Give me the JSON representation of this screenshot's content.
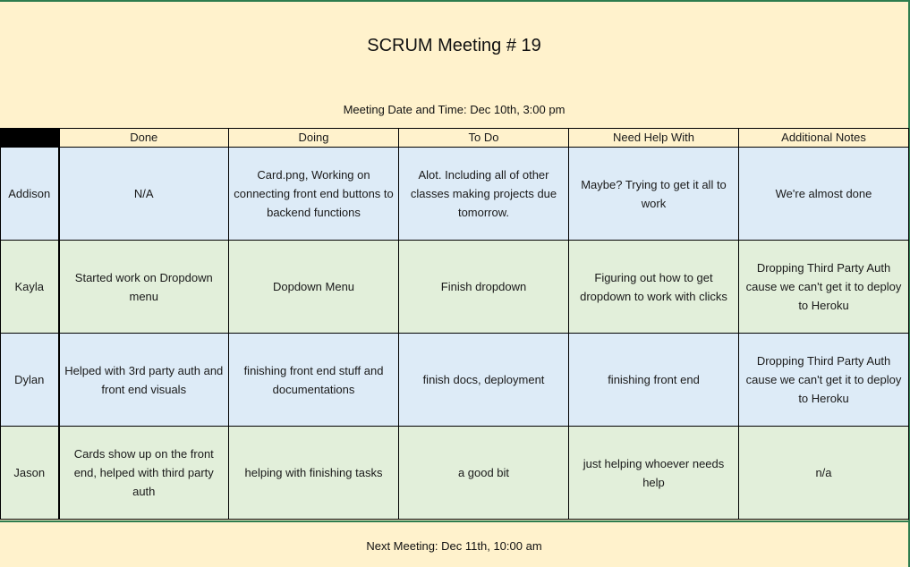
{
  "title": "SCRUM Meeting # 19",
  "meeting_date": "Meeting Date and Time: Dec 10th, 3:00 pm",
  "columns": [
    "Done",
    "Doing",
    "To Do",
    "Need Help With",
    "Additional Notes"
  ],
  "rows": [
    {
      "name": "Addison",
      "cells": [
        "N/A",
        "Card.png, Working on connecting front end buttons to backend functions",
        "Alot. Including all of other classes making projects due tomorrow.",
        "Maybe? Trying to get it all to work",
        "We're almost done"
      ]
    },
    {
      "name": "Kayla",
      "cells": [
        "Started work on Dropdown menu",
        "Dopdown Menu",
        "Finish dropdown",
        "Figuring out how to get dropdown to work with clicks",
        "Dropping Third Party Auth cause we can't get it to deploy to Heroku"
      ]
    },
    {
      "name": "Dylan",
      "cells": [
        "Helped with 3rd party auth and front end  visuals",
        "finishing front end stuff and documentations",
        "finish docs, deployment",
        "finishing front end",
        "Dropping Third Party Auth cause we can't get it to deploy to Heroku"
      ]
    },
    {
      "name": "Jason",
      "cells": [
        "Cards show up on the front end, helped with third party auth",
        "helping with finishing tasks",
        "a good bit",
        "just helping whoever needs help",
        "n/a"
      ]
    }
  ],
  "next_meeting": "Next Meeting: Dec 11th, 10:00 am",
  "colors": {
    "header_background": "#fff2cc",
    "row_blue": "#ddebf7",
    "row_green": "#e2efda",
    "border_green": "#2e7d4f"
  }
}
